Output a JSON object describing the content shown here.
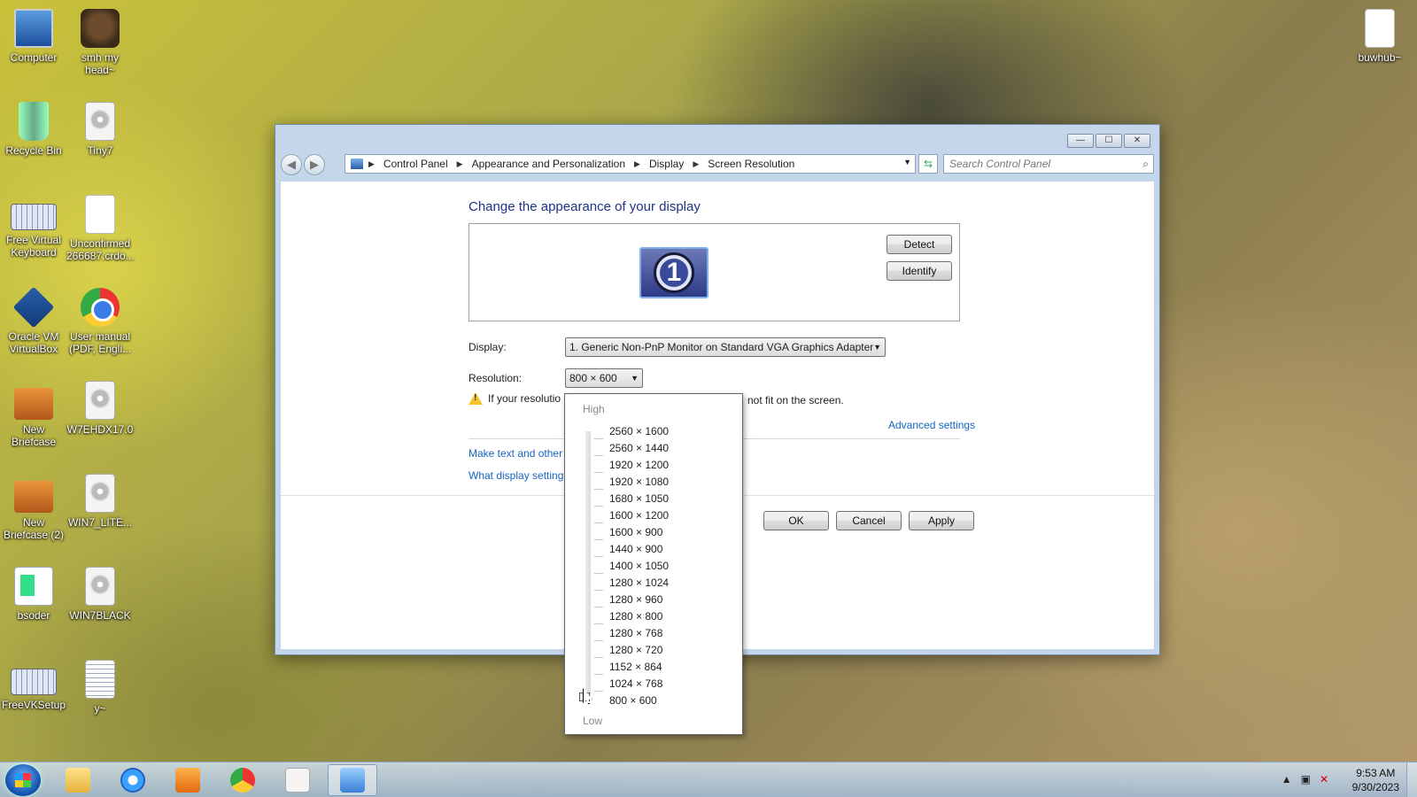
{
  "desktop_icons": [
    {
      "label": "Computer",
      "icon": "computer-icon"
    },
    {
      "label": "smh my head~",
      "icon": "cat-photo-icon"
    },
    {
      "label": "Recycle Bin",
      "icon": "recycle-bin-icon"
    },
    {
      "label": "Tiny7",
      "icon": "disc-image-icon"
    },
    {
      "label": "Free Virtual Keyboard",
      "icon": "keyboard-icon"
    },
    {
      "label": "Unconfirmed 266687.crdo...",
      "icon": "blank-file-icon"
    },
    {
      "label": "Oracle VM VirtualBox",
      "icon": "virtualbox-icon"
    },
    {
      "label": "User manual (PDF, Engli...",
      "icon": "chrome-icon"
    },
    {
      "label": "New Briefcase",
      "icon": "briefcase-icon"
    },
    {
      "label": "W7EHDX17.0",
      "icon": "disc-image-icon"
    },
    {
      "label": "New Briefcase (2)",
      "icon": "briefcase-icon"
    },
    {
      "label": "WIN7_LITE...",
      "icon": "disc-image-icon"
    },
    {
      "label": "bsoder",
      "icon": "bsoder-app-icon"
    },
    {
      "label": "WIN7BLACK",
      "icon": "disc-image-icon"
    },
    {
      "label": "FreeVKSetup",
      "icon": "keyboard-icon"
    },
    {
      "label": "y~",
      "icon": "text-document-icon"
    },
    {
      "label": "buwhub~",
      "icon": "blank-file-icon"
    }
  ],
  "window": {
    "title_buttons": {
      "minimize": "—",
      "maximize": "☐",
      "close": "✕"
    },
    "nav": {
      "back": "◀",
      "forward": "▶"
    },
    "breadcrumbs": [
      "Control Panel",
      "Appearance and Personalization",
      "Display",
      "Screen Resolution"
    ],
    "search_placeholder": "Search Control Panel",
    "heading": "Change the appearance of your display",
    "monitor_number": "1",
    "detect_label": "Detect",
    "identify_label": "Identify",
    "display_label": "Display:",
    "display_value": "1. Generic Non-PnP Monitor on Standard VGA Graphics Adapter",
    "resolution_label": "Resolution:",
    "resolution_value": "800 × 600",
    "warning_left": "If your resolutio",
    "warning_right": "not fit on the screen.",
    "advanced_link": "Advanced settings",
    "link_text_size": "Make text and other",
    "link_display_settings": "What display setting",
    "ok_label": "OK",
    "cancel_label": "Cancel",
    "apply_label": "Apply"
  },
  "resolution_popup": {
    "high_label": "High",
    "low_label": "Low",
    "options": [
      "2560 × 1600",
      "2560 × 1440",
      "1920 × 1200",
      "1920 × 1080",
      "1680 × 1050",
      "1600 × 1200",
      "1600 × 900",
      "1440 × 900",
      "1400 × 1050",
      "1280 × 1024",
      "1280 × 960",
      "1280 × 800",
      "1280 × 768",
      "1280 × 720",
      "1152 × 864",
      "1024 × 768",
      "800 × 600"
    ],
    "selected": "800 × 600"
  },
  "taskbar": {
    "apps": [
      "windows-explorer",
      "internet-explorer",
      "media-player",
      "chrome",
      "disc-image",
      "control-panel"
    ],
    "time": "9:53 AM",
    "date": "9/30/2023"
  }
}
